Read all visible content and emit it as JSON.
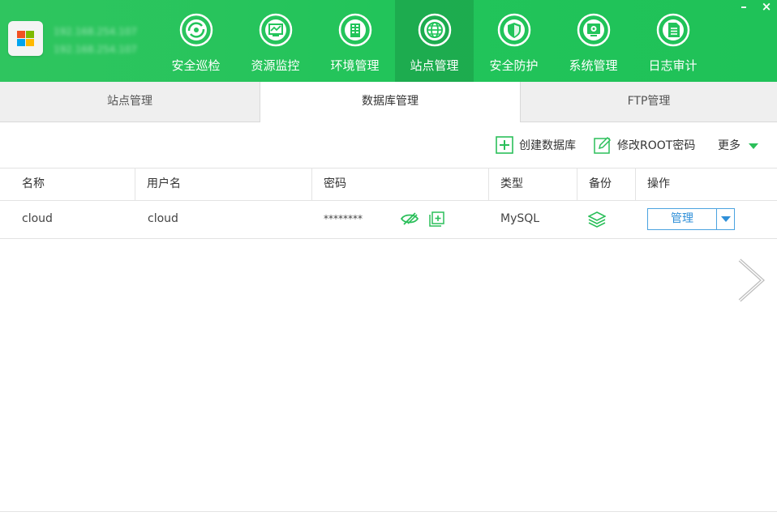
{
  "app": {
    "host_line1": "192.168.254.107",
    "host_line2": "192.168.254.107"
  },
  "window_controls": {
    "minimize": "–",
    "close": "×"
  },
  "nav": [
    {
      "label": "安全巡检",
      "icon": "security-scan-icon"
    },
    {
      "label": "资源监控",
      "icon": "resource-monitor-icon"
    },
    {
      "label": "环境管理",
      "icon": "environment-icon"
    },
    {
      "label": "站点管理",
      "icon": "globe-icon",
      "active": true
    },
    {
      "label": "安全防护",
      "icon": "shield-icon"
    },
    {
      "label": "系统管理",
      "icon": "system-settings-icon"
    },
    {
      "label": "日志审计",
      "icon": "log-document-icon"
    }
  ],
  "tabs": [
    {
      "label": "站点管理"
    },
    {
      "label": "数据库管理",
      "active": true
    },
    {
      "label": "FTP管理"
    }
  ],
  "toolbar": {
    "create_db": "创建数据库",
    "modify_root": "修改ROOT密码",
    "more": "更多"
  },
  "table": {
    "columns": [
      "名称",
      "用户名",
      "密码",
      "类型",
      "备份",
      "操作"
    ],
    "rows": [
      {
        "name": "cloud",
        "user": "cloud",
        "password": "********",
        "type": "MySQL",
        "action": "管理"
      }
    ]
  },
  "colors": {
    "header_green": "#22c45a",
    "accent_green": "#2bbf5a",
    "accent_blue": "#2f8fd8"
  }
}
